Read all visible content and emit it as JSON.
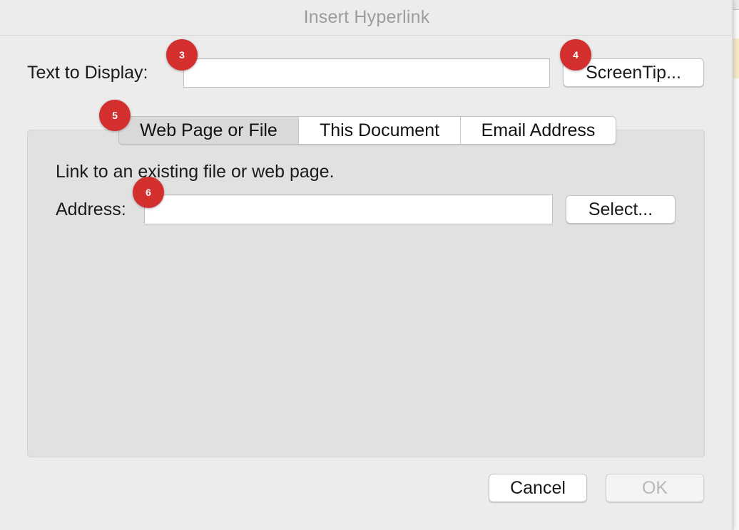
{
  "dialog": {
    "title": "Insert Hyperlink",
    "text_to_display": {
      "label": "Text to Display:",
      "value": ""
    },
    "screentip_label": "ScreenTip...",
    "tabs": [
      {
        "label": "Web Page or File",
        "active": true
      },
      {
        "label": "This Document",
        "active": false
      },
      {
        "label": "Email Address",
        "active": false
      }
    ],
    "web_page": {
      "description": "Link to an existing file or web page.",
      "address": {
        "label": "Address:",
        "value": ""
      },
      "select_label": "Select..."
    },
    "cancel_label": "Cancel",
    "ok_label": "OK",
    "ok_disabled": true
  },
  "annotations": [
    {
      "number": "3"
    },
    {
      "number": "4"
    },
    {
      "number": "5"
    },
    {
      "number": "6"
    }
  ],
  "colors": {
    "badge": "#d32f2f",
    "dialog_background": "#ececec",
    "panel_background": "#e1e1e1",
    "title_text": "#9d9d9d",
    "disabled_text": "#b9b9b9"
  }
}
